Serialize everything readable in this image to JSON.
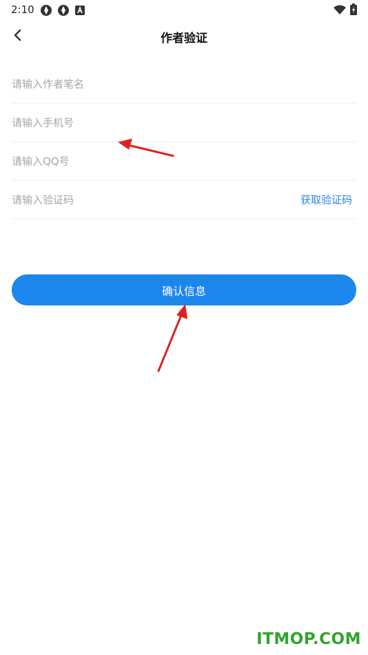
{
  "status_bar": {
    "time": "2:10",
    "left_icons": [
      "aperture-icon",
      "aperture-icon",
      "a-square-icon"
    ],
    "right_icons": [
      "wifi-icon",
      "battery-icon"
    ]
  },
  "header": {
    "title": "作者验证",
    "back_icon": "chevron-left-icon"
  },
  "form": {
    "pen_name_placeholder": "请输入作者笔名",
    "phone_placeholder": "请输入手机号",
    "qq_placeholder": "请输入QQ号",
    "code_placeholder": "请输入验证码",
    "get_code_label": "获取验证码"
  },
  "confirm_button": {
    "label": "确认信息"
  },
  "watermark": "ITMOP.COM",
  "colors": {
    "accent": "#1d86ec",
    "link": "#2a86e6",
    "annotation_arrow": "#e02020",
    "watermark": "#2fa52b"
  }
}
